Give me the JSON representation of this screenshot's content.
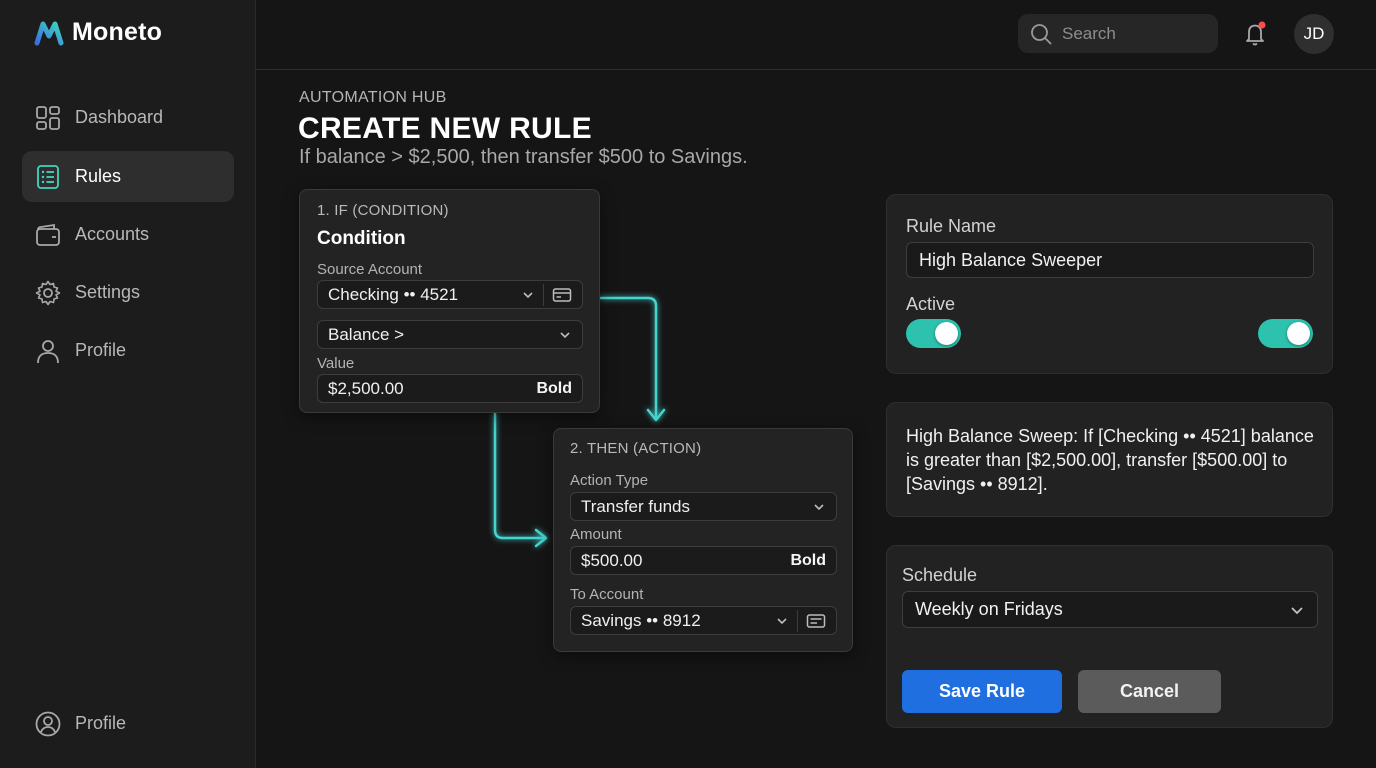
{
  "app": {
    "name": "Moneto"
  },
  "sidebar": {
    "items": [
      {
        "label": "Dashboard",
        "icon": "dashboard-icon",
        "active": false
      },
      {
        "label": "Rules",
        "icon": "rules-list-icon",
        "active": true
      },
      {
        "label": "Accounts",
        "icon": "wallet-icon",
        "active": false
      },
      {
        "label": "Settings",
        "icon": "gear-icon",
        "active": false
      },
      {
        "label": "Profile",
        "icon": "user-icon",
        "active": false
      }
    ],
    "footer": {
      "label": "Profile",
      "icon": "user-circle-icon"
    }
  },
  "topbar": {
    "search_placeholder": "Search",
    "avatar_initials": "JD",
    "notification_dot": true
  },
  "header": {
    "eyebrow": "AUTOMATION HUB",
    "title": "CREATE NEW RULE",
    "subtitle": "If balance > $2,500, then transfer $500 to Savings."
  },
  "condition_card": {
    "step": "1. IF (CONDITION)",
    "heading": "Condition",
    "source_label": "Source Account",
    "source_value": "Checking •• 4521",
    "operator_value": "Balance >",
    "value_label": "Value",
    "value": "$2,500.00",
    "value_tag": "Bold"
  },
  "action_card": {
    "step": "2. THEN (ACTION)",
    "action_type_label": "Action Type",
    "action_type_value": "Transfer funds",
    "amount_label": "Amount",
    "amount_value": "$500.00",
    "amount_tag": "Bold",
    "to_label": "To Account",
    "to_value": "Savings •• 8912"
  },
  "rule_panel": {
    "name_label": "Rule Name",
    "name_value": "High Balance Sweeper",
    "active_label": "Active",
    "active": true
  },
  "summary": {
    "text": "High Balance Sweep: If [Checking •• 4521] balance is greater than [$2,500.00], transfer [$500.00] to [Savings •• 8912]."
  },
  "schedule_panel": {
    "label": "Schedule",
    "value": "Weekly on Fridays",
    "save_label": "Save Rule",
    "cancel_label": "Cancel"
  },
  "colors": {
    "accent_teal": "#2cc2ad",
    "connector": "#45d4cf",
    "primary_button": "#1f6fe0",
    "notification": "#ff4a4a"
  }
}
